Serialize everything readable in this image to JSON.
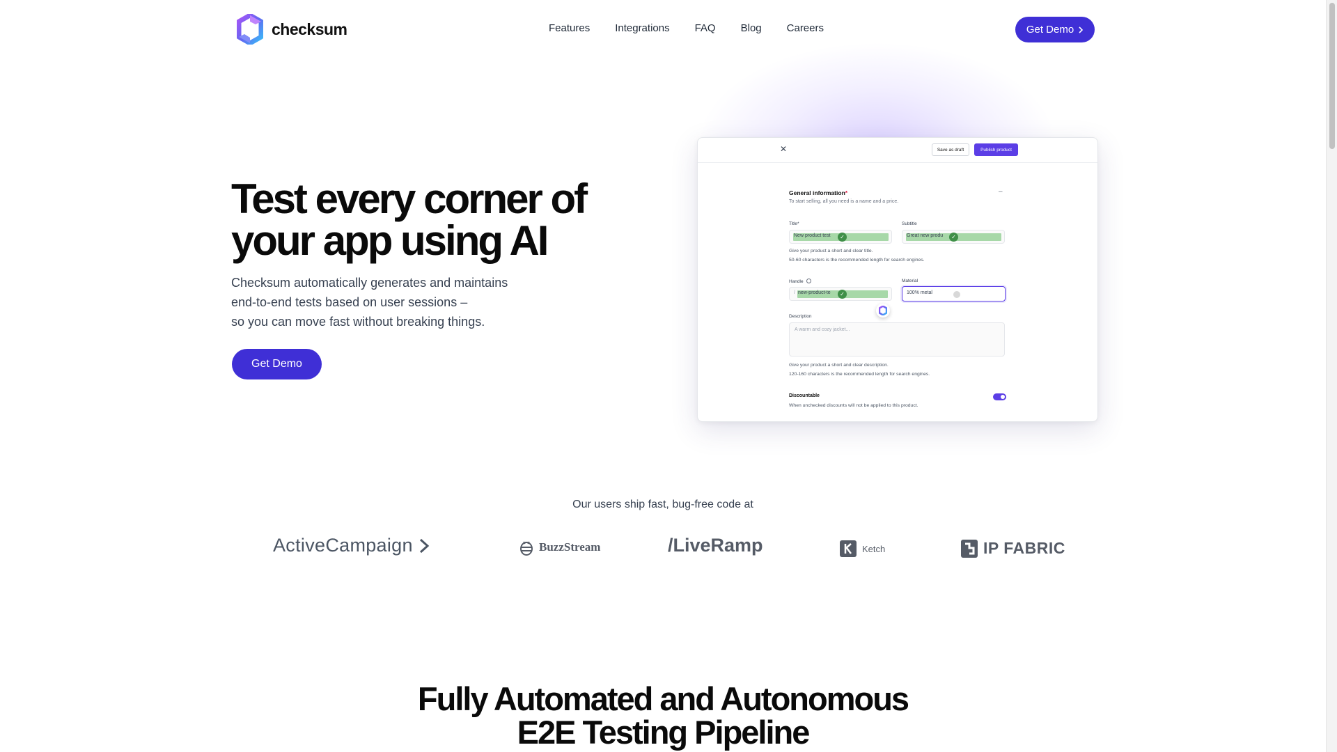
{
  "brand": {
    "name": "checksum"
  },
  "nav": {
    "items": [
      {
        "label": "Features"
      },
      {
        "label": "Integrations"
      },
      {
        "label": "FAQ"
      },
      {
        "label": "Blog"
      },
      {
        "label": "Careers"
      }
    ],
    "cta_label": "Get Demo",
    "cta_icon": "chevron-right-icon"
  },
  "hero": {
    "title_line1": "Test every corner of",
    "title_line2": "your app using AI",
    "subtitle_lines": [
      "Checksum automatically generates and maintains",
      "end-to-end tests based on user sessions –",
      "so you can move fast without breaking things."
    ],
    "cta_label": "Get Demo"
  },
  "mock_form": {
    "close_icon": "✕",
    "save_draft_label": "Save as draft",
    "publish_label": "Publish product",
    "section_title": "General information",
    "section_required": "*",
    "section_subtitle": "To start selling, all you need is a name and a price.",
    "collapse_icon": "–",
    "title_label": "Title*",
    "title_value": "New product test",
    "subtitle_label": "Subtitle",
    "subtitle_value": "Great new produ",
    "title_help_1": "Give your product a short and clear title.",
    "title_help_2": "50-60 characters is the recommended length for search engines.",
    "handle_label": "Handle",
    "handle_prefix": "/",
    "handle_value": "new-product-te",
    "material_label": "Material",
    "material_value": "100% metal",
    "description_label": "Description",
    "description_placeholder": "A warm and cozy jacket...",
    "desc_help_1": "Give your product a short and clear description.",
    "desc_help_2": "120-160 characters is the recommended length for search engines.",
    "discountable_label": "Discountable",
    "discountable_help": "When unchecked discounts will not be applied to this product.",
    "discountable_on": true
  },
  "trust": {
    "heading": "Our users ship fast, bug-free code at",
    "logos": [
      {
        "name": "ActiveCampaign",
        "suffix": ">"
      },
      {
        "name": "BuzzStream"
      },
      {
        "name": "/LiveRamp"
      },
      {
        "name": "Ketch"
      },
      {
        "name": "IP FABRIC"
      }
    ]
  },
  "section": {
    "title_line1": "Fully Automated and Autonomous",
    "title_line2": "E2E Testing Pipeline"
  },
  "colors": {
    "accent": "#3f2fd6",
    "accent_light": "#5b3ee6",
    "highlight_green": "#a7d8a8",
    "check_green": "#3f8f48"
  }
}
